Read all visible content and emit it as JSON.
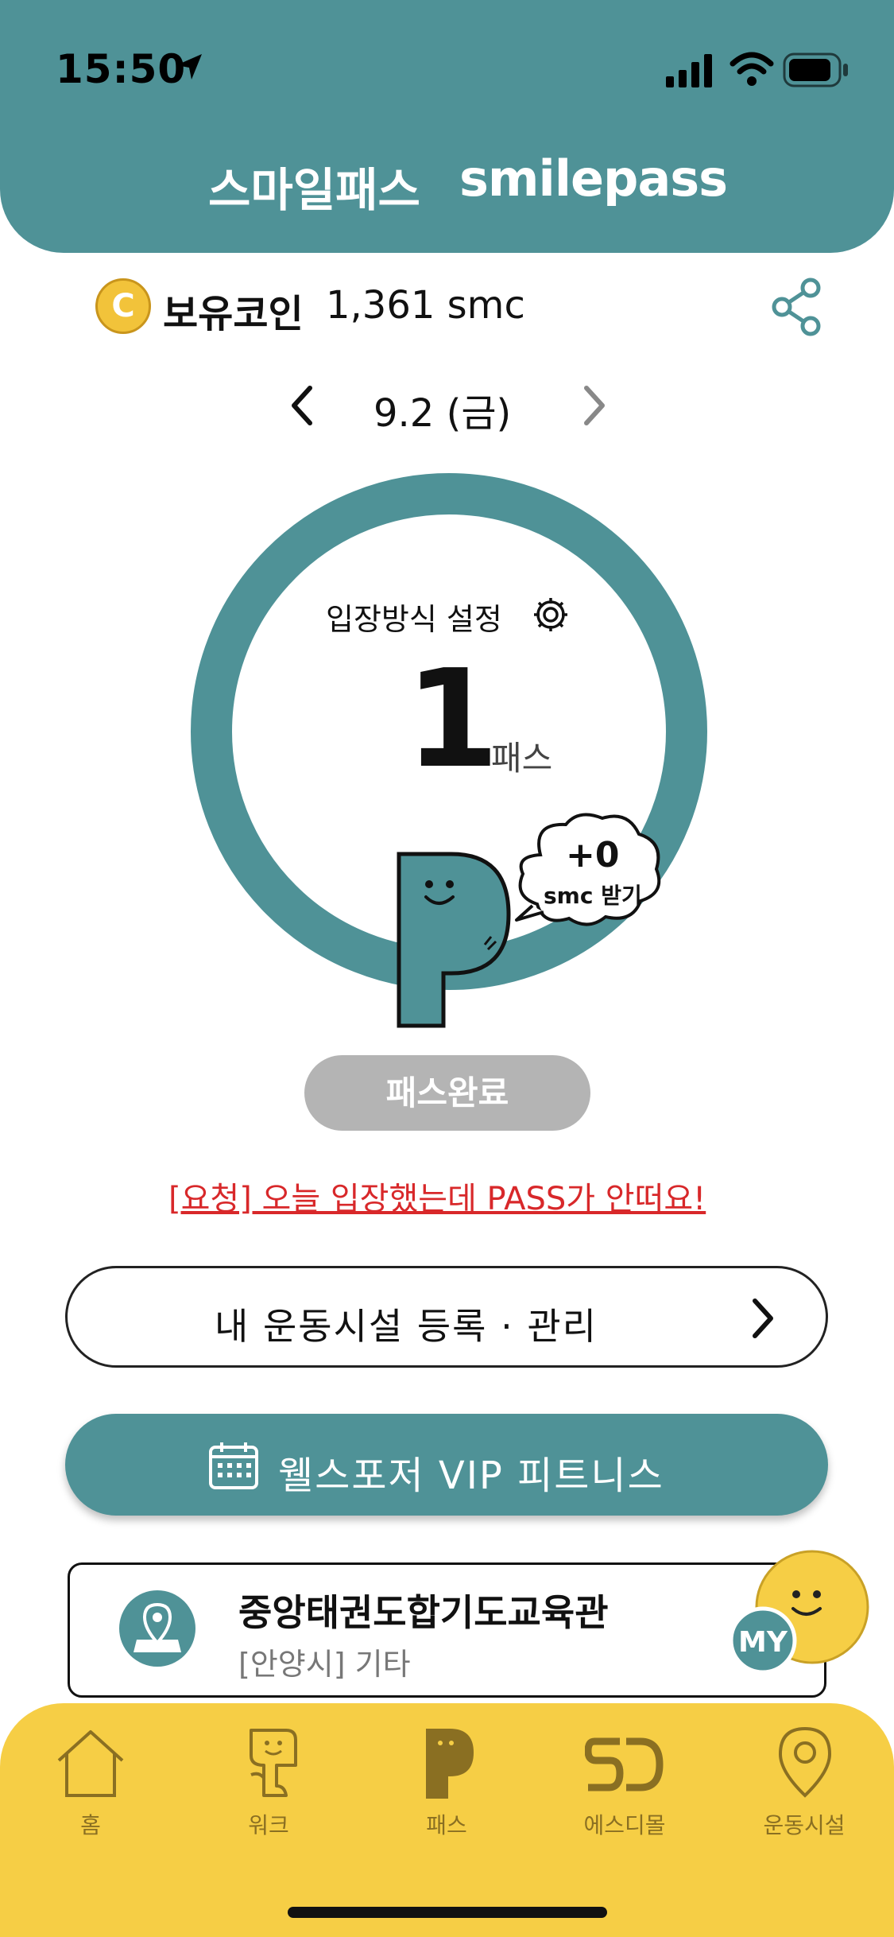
{
  "status_bar": {
    "time": "15:50"
  },
  "header": {
    "title_ko": "스마일패스",
    "title_en": "smilepass"
  },
  "coin": {
    "icon": "coin-icon",
    "symbol": "C",
    "label": "보유코인",
    "value": "1,361 smc"
  },
  "date_nav": {
    "date": "9.2 (금)"
  },
  "pass_ring": {
    "entry_setting_label": "입장방식 설정",
    "count": "1",
    "unit": "패스",
    "bubble_plus": "+0",
    "bubble_action": "smc 받기"
  },
  "pass_complete_label": "패스완료",
  "request_link": "[요청] 오늘 입장했는데 PASS가 안떠요!",
  "manage_button": {
    "label": "내 운동시설 등록 · 관리"
  },
  "vip_button": {
    "label": "웰스포저 VIP 피트니스"
  },
  "facility": {
    "name": "중앙태권도합기도교육관",
    "sub": "[안양시] 기타",
    "badge": "MY"
  },
  "tabs": [
    {
      "label": "홈",
      "icon": "home-icon"
    },
    {
      "label": "워크",
      "icon": "walk-icon"
    },
    {
      "label": "패스",
      "icon": "pass-icon"
    },
    {
      "label": "에스디몰",
      "icon": "sd-mall-icon"
    },
    {
      "label": "운동시설",
      "icon": "location-pin-icon"
    }
  ],
  "colors": {
    "teal": "#4f9297",
    "yellow": "#f6ce45",
    "red": "#d8282a",
    "gray": "#b4b4b4"
  }
}
